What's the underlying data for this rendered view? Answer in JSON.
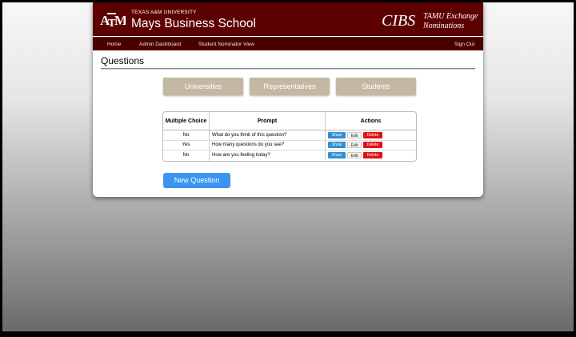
{
  "header": {
    "university": "TEXAS A&M UNIVERSITY",
    "school": "Mays Business School",
    "brand": "CIBS",
    "subtitle_line1": "TAMU Exchange",
    "subtitle_line2": "Nominations",
    "logo_text": "ATM",
    "banner_color": "#5c0000"
  },
  "nav": {
    "items": [
      "Home",
      "Admin Dashboard",
      "Student Nominator View"
    ],
    "sign_out": "Sign Out"
  },
  "page": {
    "title": "Questions"
  },
  "tabs": [
    "Universities",
    "Representatives",
    "Students"
  ],
  "table": {
    "headers": [
      "Multiple Choice",
      "Prompt",
      "Actions"
    ],
    "rows": [
      {
        "multiple_choice": "No",
        "prompt": "What do you think of this question?"
      },
      {
        "multiple_choice": "Yes",
        "prompt": "How many questions do you see?"
      },
      {
        "multiple_choice": "No",
        "prompt": "How are you feeling today?"
      }
    ],
    "actions": {
      "show": "Show",
      "edit": "Edit",
      "delete": "Delete"
    }
  },
  "new_question_label": "New Question"
}
